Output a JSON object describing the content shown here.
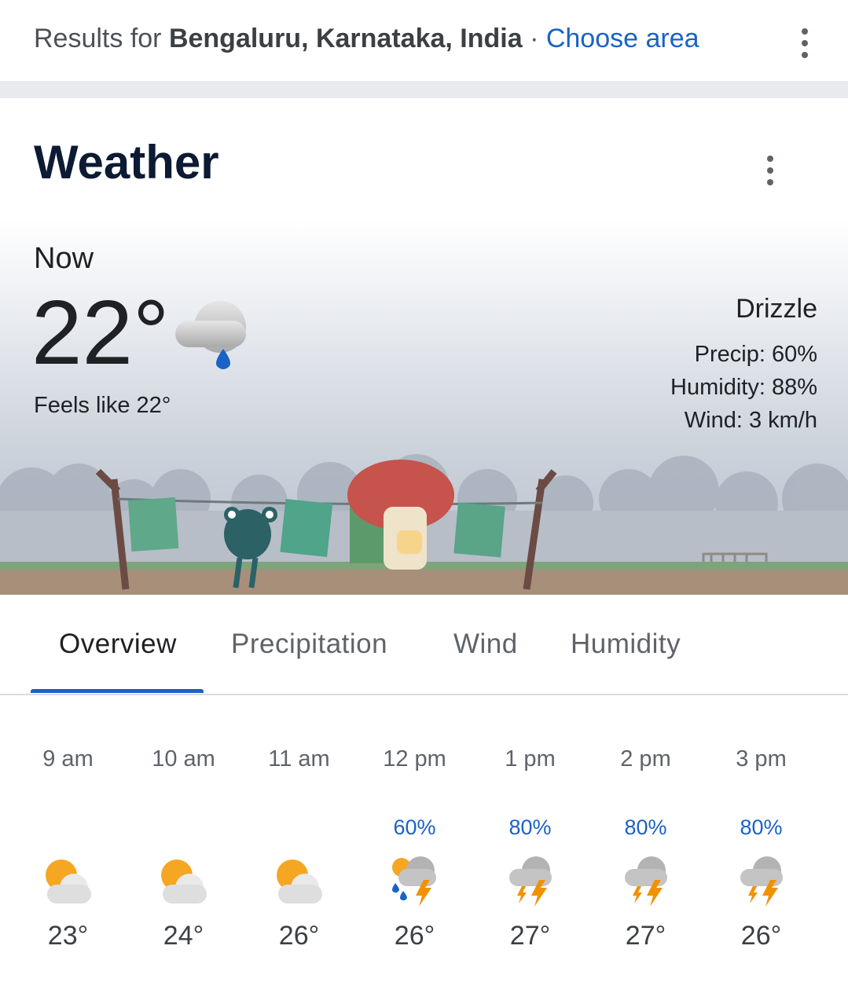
{
  "header": {
    "results_prefix": "Results for ",
    "location": "Bengaluru, Karnataka, India",
    "separator": " · ",
    "choose_area": "Choose area"
  },
  "card": {
    "title": "Weather"
  },
  "current": {
    "label": "Now",
    "temperature": "22°",
    "icon": "drizzle-icon",
    "feels_like": "Feels like 22°",
    "condition": "Drizzle",
    "precip": "Precip: 60%",
    "humidity": "Humidity: 88%",
    "wind": "Wind: 3 km/h"
  },
  "tabs": [
    {
      "label": "Overview",
      "active": true
    },
    {
      "label": "Precipitation"
    },
    {
      "label": "Wind"
    },
    {
      "label": "Humidity"
    }
  ],
  "colors": {
    "accent": "#1a62c6",
    "sun": "#f5a623",
    "bolt": "#f29100",
    "drop": "#1a62c6"
  },
  "hourly": [
    {
      "time": "9 am",
      "precip": "",
      "icon": "partly-cloudy",
      "temp": "23°"
    },
    {
      "time": "10 am",
      "precip": "",
      "icon": "partly-cloudy",
      "temp": "24°"
    },
    {
      "time": "11 am",
      "precip": "",
      "icon": "partly-cloudy",
      "temp": "26°"
    },
    {
      "time": "12 pm",
      "precip": "60%",
      "icon": "scattered-thunderstorms",
      "temp": "26°"
    },
    {
      "time": "1 pm",
      "precip": "80%",
      "icon": "thunderstorms",
      "temp": "27°"
    },
    {
      "time": "2 pm",
      "precip": "80%",
      "icon": "thunderstorms",
      "temp": "27°"
    },
    {
      "time": "3 pm",
      "precip": "80%",
      "icon": "thunderstorms",
      "temp": "26°"
    }
  ]
}
